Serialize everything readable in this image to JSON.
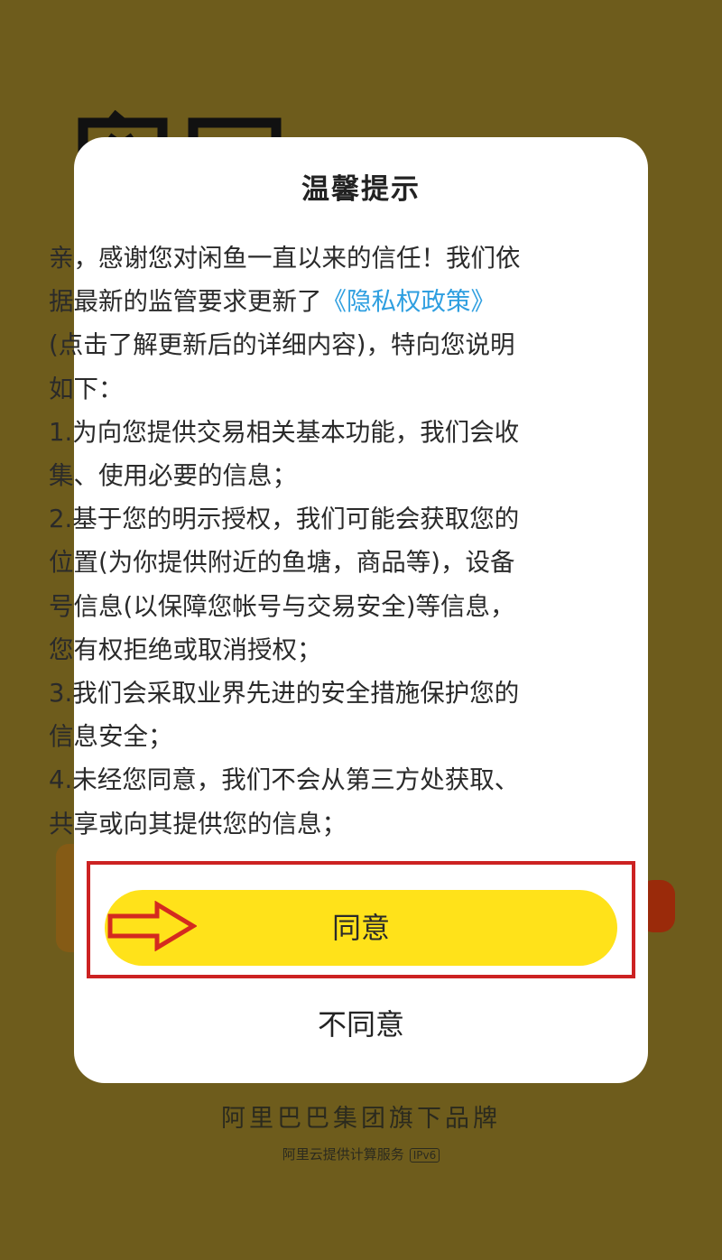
{
  "dialog": {
    "title": "温馨提示",
    "intro_before_link": "亲，感谢您对闲鱼一直以来的信任！我们依据最新的监管要求更新了",
    "policy_link": "《隐私权政策》",
    "intro_after_link": "(点击了解更新后的详细内容)，特向您说明如下：",
    "items": [
      "1.为向您提供交易相关基本功能，我们会收集、使用必要的信息；",
      "2.基于您的明示授权，我们可能会获取您的位置(为你提供附近的鱼塘，商品等)，设备号信息(以保障您帐号与交易安全)等信息，您有权拒绝或取消授权；",
      "3.我们会采取业界先进的安全措施保护您的信息安全；",
      "4.未经您同意，我们不会从第三方处获取、共享或向其提供您的信息；"
    ],
    "agree_label": "同意",
    "disagree_label": "不同意"
  },
  "footer": {
    "brand": "阿里巴巴集团旗下品牌",
    "service": "阿里云提供计算服务",
    "badge": "IPv6"
  },
  "icons": {
    "annotation_arrow": "arrow-right-icon",
    "background_logo": "xianyu-logo"
  },
  "colors": {
    "background": "#6e5c1c",
    "agree_button": "#ffe21a",
    "link": "#2f9fe0",
    "highlight_box": "#cc2222"
  }
}
